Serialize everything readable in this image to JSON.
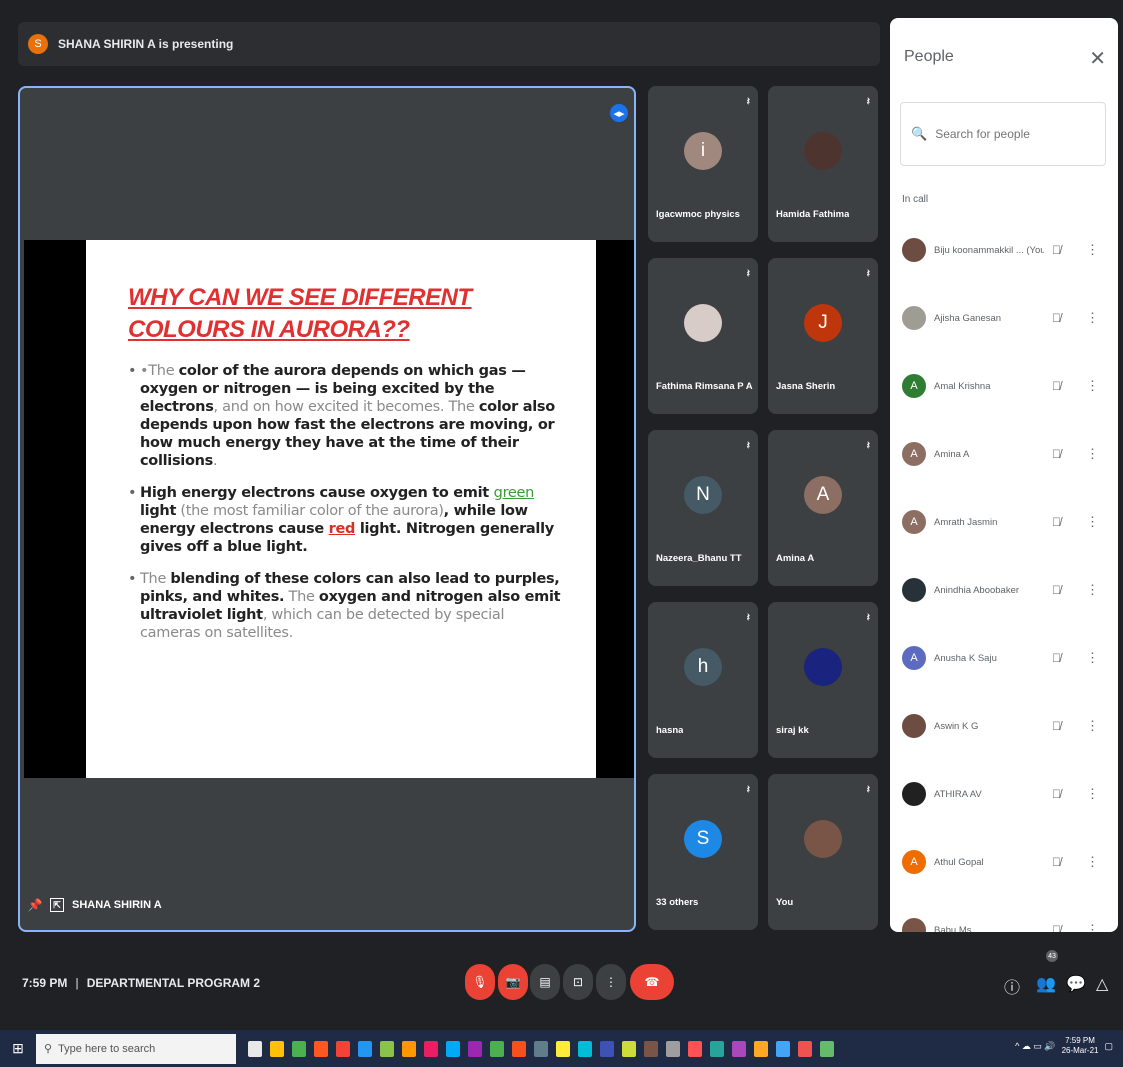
{
  "presenter": {
    "initial": "S",
    "banner": "SHANA SHIRIN A is presenting",
    "name_label": "SHANA SHIRIN A"
  },
  "slide": {
    "title": "WHY CAN WE SEE DIFFERENT COLOURS IN AURORA??",
    "b1": {
      "t1": "•The ",
      "b1": "color of the aurora depends on which gas — oxygen or nitrogen — is being excited by the electrons",
      "t2": ", and on how excited it becomes. The ",
      "b2": "color also depends upon how fast the electrons are moving, or how much energy they have at the time of their collisions",
      "t3": "."
    },
    "b2": {
      "b1": "High energy electrons cause oxygen to emit ",
      "green": "green",
      "b2": " light",
      "t1": " (the most familiar color of the aurora)",
      "b3": ", while low energy electrons cause ",
      "red": "red",
      "b4": " light. Nitrogen generally gives off a blue light."
    },
    "b3": {
      "t1": "The ",
      "b1": "blending of these colors can also lead to purples, pinks, and whites.",
      "t2": " The ",
      "b2": "oxygen and nitrogen also emit ultraviolet light",
      "t3": ", which can be detected by special cameras on satellites."
    }
  },
  "tiles": [
    {
      "initial": "i",
      "name": "lgacwmoc physics",
      "color": "#a1887f"
    },
    {
      "initial": "",
      "name": "Hamida Fathima",
      "color": "#4e342e"
    },
    {
      "initial": "",
      "name": "Fathima Rimsana P A",
      "color": "#d7ccc8"
    },
    {
      "initial": "J",
      "name": "Jasna Sherin",
      "color": "#bf360c"
    },
    {
      "initial": "N",
      "name": "Nazeera_Bhanu TT",
      "color": "#455a64"
    },
    {
      "initial": "A",
      "name": "Amina A",
      "color": "#8d6e63"
    },
    {
      "initial": "h",
      "name": "hasna",
      "color": "#455a64"
    },
    {
      "initial": "",
      "name": "siraj kk",
      "color": "#1a237e"
    },
    {
      "initial": "S",
      "name": "33 others",
      "color": "#1e88e5"
    },
    {
      "initial": "",
      "name": "You",
      "color": "#795548"
    }
  ],
  "people": {
    "title": "People",
    "close": "✕",
    "search_placeholder": "Search for people",
    "section": "In call",
    "list": [
      {
        "initial": "",
        "name": "Biju koonammakkil ...  (You)",
        "color": "#6d4c41"
      },
      {
        "initial": "",
        "name": "Ajisha Ganesan",
        "color": "#9e9d94"
      },
      {
        "initial": "A",
        "name": "Amal Krishna",
        "color": "#2e7d32"
      },
      {
        "initial": "A",
        "name": "Amina A",
        "color": "#8d6e63"
      },
      {
        "initial": "A",
        "name": "Amrath Jasmin",
        "color": "#8d6e63"
      },
      {
        "initial": "",
        "name": "Anindhia Aboobaker",
        "color": "#263238"
      },
      {
        "initial": "A",
        "name": "Anusha K Saju",
        "color": "#5c6bc0"
      },
      {
        "initial": "",
        "name": "Aswin K G",
        "color": "#6d4c41"
      },
      {
        "initial": "",
        "name": "ATHIRA AV",
        "color": "#212121"
      },
      {
        "initial": "A",
        "name": "Athul Gopal",
        "color": "#ef6c00"
      },
      {
        "initial": "",
        "name": "Babu Ms",
        "color": "#795548"
      }
    ]
  },
  "toolbar": {
    "time": "7:59 PM",
    "meeting": "DEPARTMENTAL PROGRAM 2",
    "people_count": "43"
  },
  "taskbar": {
    "search": "Type here to search",
    "clock": "7:59 PM",
    "date": "26-Mar-21"
  }
}
